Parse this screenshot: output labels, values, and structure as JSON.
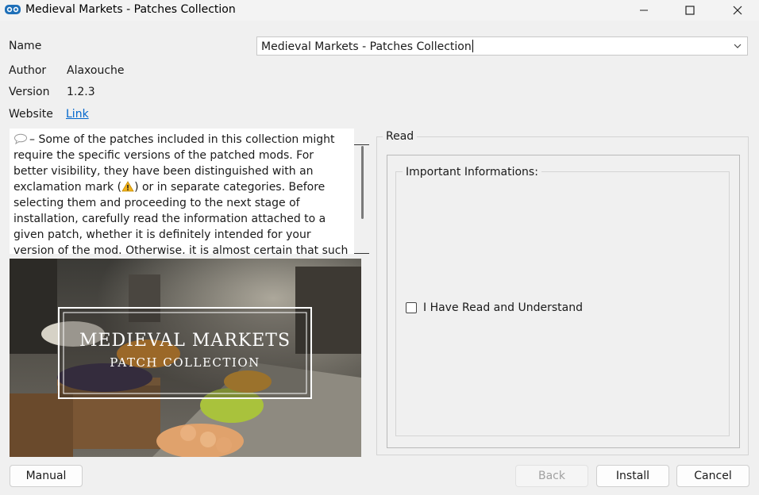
{
  "window": {
    "title": "Medieval Markets - Patches Collection",
    "icon": "app-logo-icon",
    "controls": [
      "minimize-icon",
      "maximize-icon",
      "close-icon"
    ]
  },
  "info": {
    "name_label": "Name",
    "name_value": "Medieval Markets - Patches Collection",
    "author_label": "Author",
    "author_value": "Alaxouche",
    "version_label": "Version",
    "version_value": "1.2.3",
    "website_label": "Website",
    "website_link": "Link"
  },
  "description": {
    "before_warning": "– Some of the patches included in this collection might require the specific versions of the patched mods. For better visibility, they have been distinguished with an exclamation mark (",
    "after_warning": ") or in separate categories. Before selecting them and proceeding to the next stage of installation, carefully read the information attached to a given patch, whether it is definitely intended for your version of the mod. Otherwise, it is almost certain that such a patch will cause additional issues or crash."
  },
  "banner": {
    "title": "MEDIEVAL MARKETS",
    "subtitle": "PATCH COLLECTION"
  },
  "read_group": {
    "label": "Read",
    "info_label": "Important Informations:",
    "checkbox_label": "I Have Read and Understand",
    "checked": false
  },
  "buttons": {
    "manual": "Manual",
    "back": "Back",
    "install": "Install",
    "cancel": "Cancel"
  },
  "colors": {
    "link": "#0066cc",
    "window_bg": "#f0f0f0"
  }
}
